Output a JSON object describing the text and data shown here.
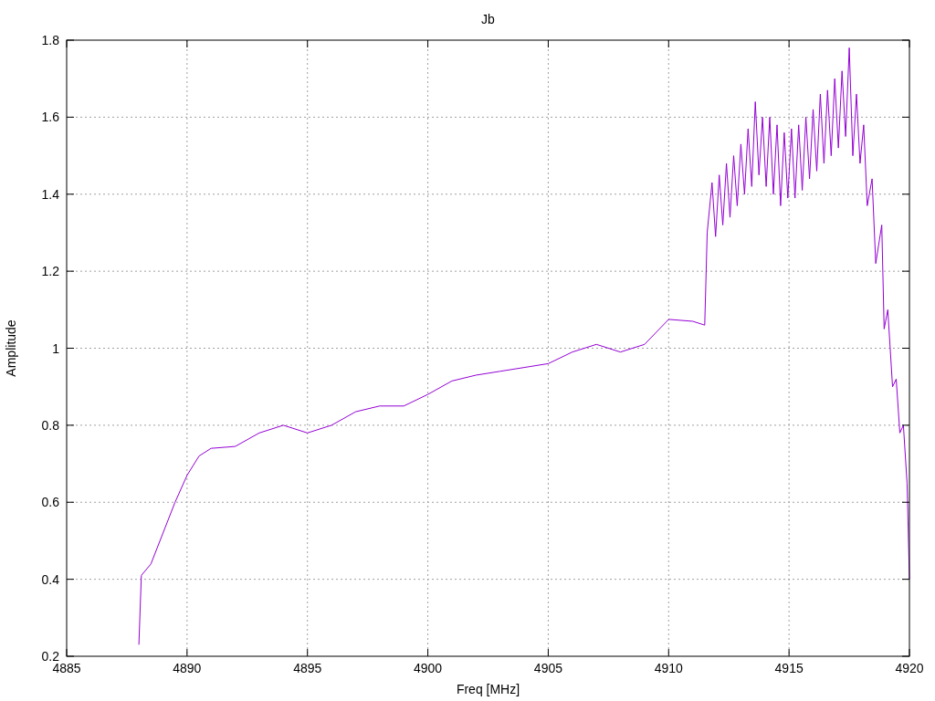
{
  "chart": {
    "chart_data": {
      "type": "line",
      "title": "Jb",
      "grid": true,
      "xlabel": "Freq [MHz]",
      "ylabel": "Amplitude",
      "xlim": [
        4885,
        4920
      ],
      "ylim": [
        0.2,
        1.8
      ],
      "xticks": [
        4885,
        4890,
        4895,
        4900,
        4905,
        4910,
        4915,
        4920
      ],
      "yticks": [
        {
          "value": 0.2,
          "label": "0.2"
        },
        {
          "value": 0.4,
          "label": "0.4"
        },
        {
          "value": 0.6,
          "label": "0.6"
        },
        {
          "value": 0.8,
          "label": "0.8"
        },
        {
          "value": 1,
          "label": "1"
        },
        {
          "value": 1.2,
          "label": "1.2"
        },
        {
          "value": 1.4,
          "label": "1.4"
        },
        {
          "value": 1.6,
          "label": "1.6"
        },
        {
          "value": 1.8,
          "label": "1.8"
        }
      ],
      "x": [
        4888.0,
        4888.1,
        4888.5,
        4889,
        4889.5,
        4890,
        4890.5,
        4891,
        4892,
        4893,
        4894,
        4895,
        4896,
        4897,
        4898,
        4899,
        4900,
        4901,
        4902,
        4903,
        4904,
        4905,
        4906,
        4907,
        4908,
        4909,
        4910,
        4911,
        4911.5,
        4911.6,
        4911.8,
        4911.95,
        4912.1,
        4912.25,
        4912.4,
        4912.55,
        4912.7,
        4912.85,
        4913.0,
        4913.15,
        4913.3,
        4913.45,
        4913.6,
        4913.75,
        4913.9,
        4914.05,
        4914.2,
        4914.35,
        4914.5,
        4914.65,
        4914.8,
        4914.95,
        4915.1,
        4915.25,
        4915.4,
        4915.55,
        4915.7,
        4915.85,
        4916.0,
        4916.15,
        4916.3,
        4916.45,
        4916.6,
        4916.75,
        4916.9,
        4917.05,
        4917.2,
        4917.35,
        4917.5,
        4917.65,
        4917.8,
        4917.95,
        4918.1,
        4918.25,
        4918.45,
        4918.6,
        4918.85,
        4918.95,
        4919.1,
        4919.3,
        4919.45,
        4919.6,
        4919.75,
        4919.9,
        4920
      ],
      "series": [
        {
          "color": "#9400d3",
          "values": [
            0.23,
            0.41,
            0.44,
            0.52,
            0.6,
            0.67,
            0.72,
            0.74,
            0.745,
            0.78,
            0.8,
            0.78,
            0.8,
            0.835,
            0.85,
            0.85,
            0.88,
            0.915,
            0.93,
            0.94,
            0.95,
            0.96,
            0.99,
            1.01,
            0.99,
            1.01,
            1.075,
            1.07,
            1.06,
            1.3,
            1.43,
            1.29,
            1.45,
            1.32,
            1.48,
            1.34,
            1.5,
            1.37,
            1.53,
            1.4,
            1.57,
            1.42,
            1.64,
            1.45,
            1.6,
            1.42,
            1.6,
            1.4,
            1.58,
            1.37,
            1.56,
            1.39,
            1.57,
            1.39,
            1.58,
            1.41,
            1.6,
            1.44,
            1.62,
            1.46,
            1.66,
            1.48,
            1.67,
            1.5,
            1.7,
            1.52,
            1.72,
            1.55,
            1.78,
            1.5,
            1.66,
            1.48,
            1.58,
            1.37,
            1.44,
            1.22,
            1.32,
            1.05,
            1.1,
            0.9,
            0.92,
            0.78,
            0.8,
            0.65,
            0.4
          ]
        }
      ]
    }
  }
}
